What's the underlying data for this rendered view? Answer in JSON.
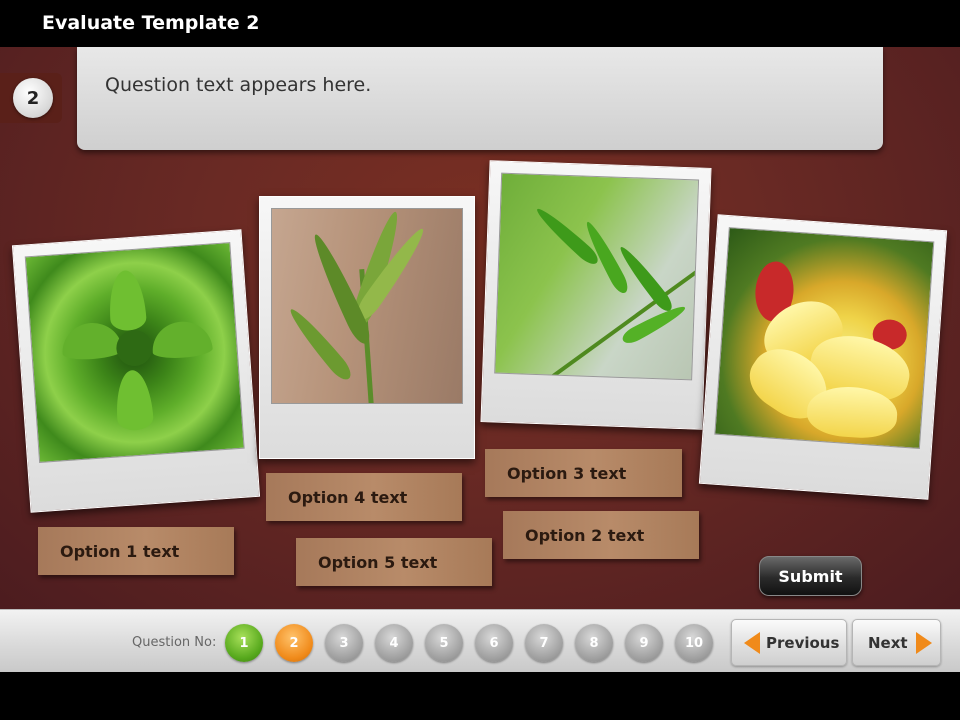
{
  "window": {
    "title": "Evaluate Template 2"
  },
  "question": {
    "number": "2",
    "text": "Question text appears here."
  },
  "images": [
    {
      "name": "succulent-rosette"
    },
    {
      "name": "plant-shoots"
    },
    {
      "name": "fern-leaf"
    },
    {
      "name": "frangipani-flower"
    }
  ],
  "options": {
    "o1": "Option 1 text",
    "o2": "Option 2 text",
    "o3": "Option 3 text",
    "o4": "Option 4 text",
    "o5": "Option 5 text"
  },
  "submit_label": "Submit",
  "nav": {
    "question_no_label": "Question No:",
    "questions": [
      "1",
      "2",
      "3",
      "4",
      "5",
      "6",
      "7",
      "8",
      "9",
      "10"
    ],
    "status": {
      "completed": [
        "1"
      ],
      "current": "2"
    },
    "previous_label": "Previous",
    "next_label": "Next"
  },
  "colors": {
    "accent": "#f08a1a",
    "completed": "#56a81c",
    "stage": "#6a2a24"
  }
}
